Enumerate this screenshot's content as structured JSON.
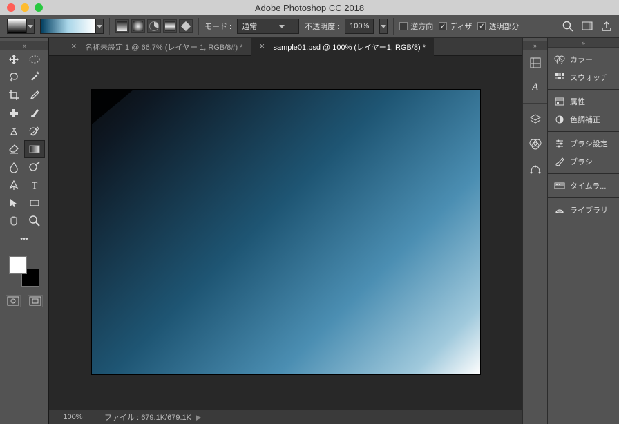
{
  "app_title": "Adobe Photoshop CC 2018",
  "options_bar": {
    "mode_label": "モード :",
    "mode_value": "通常",
    "opacity_label": "不透明度 :",
    "opacity_value": "100%",
    "reverse_label": "逆方向",
    "reverse_checked": false,
    "dither_label": "ディザ",
    "dither_checked": true,
    "transparency_label": "透明部分",
    "transparency_checked": true,
    "gradient_colors": [
      "#003c5e",
      "#a8d5e8",
      "#ffffff"
    ]
  },
  "tools": [
    [
      "move-tool",
      "rect-marquee-tool"
    ],
    [
      "lasso-tool",
      "magic-wand-tool"
    ],
    [
      "crop-tool",
      "eyedropper-tool"
    ],
    [
      "healing-brush-tool",
      "brush-tool"
    ],
    [
      "clone-stamp-tool",
      "history-brush-tool"
    ],
    [
      "eraser-tool",
      "gradient-tool"
    ],
    [
      "blur-tool",
      "dodge-tool"
    ],
    [
      "pen-tool",
      "type-tool"
    ],
    [
      "path-selection-tool",
      "rectangle-tool"
    ],
    [
      "hand-tool",
      "zoom-tool"
    ]
  ],
  "active_tool": "gradient-tool",
  "colors": {
    "foreground": "#ffffff",
    "background": "#000000"
  },
  "tabs": [
    {
      "title": "名称未設定 1 @ 66.7% (レイヤー 1, RGB/8#) *",
      "active": false
    },
    {
      "title": "sample01.psd @ 100% (レイヤー1, RGB/8) *",
      "active": true
    }
  ],
  "status": {
    "zoom": "100%",
    "file_label": "ファイル :",
    "file_info": "679.1K/679.1K"
  },
  "dock_left_icons": [
    "guides-icon",
    "character-icon",
    "layers-icon",
    "channels-icon",
    "paths-icon"
  ],
  "panels": [
    {
      "group": 0,
      "icon": "color-icon",
      "label": "カラー"
    },
    {
      "group": 0,
      "icon": "swatches-icon",
      "label": "スウォッチ"
    },
    {
      "group": 1,
      "icon": "properties-icon",
      "label": "属性"
    },
    {
      "group": 1,
      "icon": "adjustments-icon",
      "label": "色調補正"
    },
    {
      "group": 2,
      "icon": "brush-settings-icon",
      "label": "ブラシ設定"
    },
    {
      "group": 2,
      "icon": "brushes-icon",
      "label": "ブラシ"
    },
    {
      "group": 3,
      "icon": "timeline-icon",
      "label": "タイムラ..."
    },
    {
      "group": 4,
      "icon": "libraries-icon",
      "label": "ライブラリ"
    }
  ],
  "chart_data": null
}
